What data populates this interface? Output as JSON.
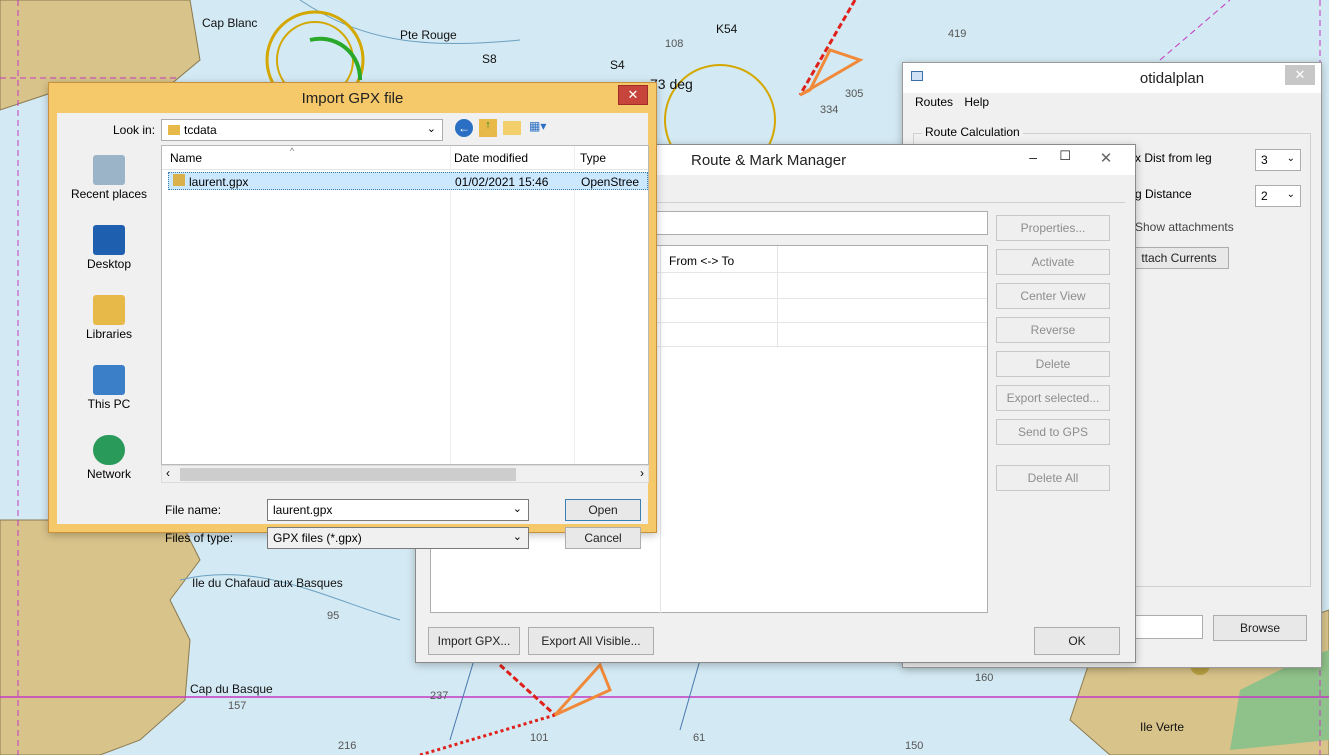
{
  "chart_labels": {
    "cap_blanc": "Cap Blanc",
    "pte_rouge": "Pte Rouge",
    "ile_chafaud": "Ile du Chafaud aux Basques",
    "cap_basque": "Cap du Basque",
    "ile_verte": "Ile Verte",
    "heading": "73 deg",
    "k54": "K54",
    "s8": "S8",
    "s4": "S4",
    "d419": "419",
    "d108": "108",
    "d305": "305",
    "d334": "334",
    "d160": "160",
    "d95": "95",
    "d157": "157",
    "d216": "216",
    "d237": "237",
    "d150": "150",
    "d61": "61",
    "d101": "101"
  },
  "import_gpx": {
    "title": "Import GPX file",
    "close": "✕",
    "look_in_label": "Look in:",
    "look_in_value": "tcdata",
    "places": [
      "Recent places",
      "Desktop",
      "Libraries",
      "This PC",
      "Network"
    ],
    "columns": {
      "name": "Name",
      "date": "Date modified",
      "type": "Type"
    },
    "file": {
      "name": "laurent.gpx",
      "date": "01/02/2021 15:46",
      "type": "OpenStree"
    },
    "file_name_label": "File name:",
    "file_name_value": "laurent.gpx",
    "file_type_label": "Files of type:",
    "file_type_value": "GPX files (*.gpx)",
    "open": "Open",
    "cancel": "Cancel"
  },
  "route_manager": {
    "title": "Route & Mark Manager",
    "column": "From <-> To",
    "buttons": [
      "Properties...",
      "Activate",
      "Center View",
      "Reverse",
      "Delete",
      "Export selected...",
      "Send to GPS",
      "Delete All"
    ],
    "import_gpx": "Import GPX...",
    "export_all": "Export All Visible...",
    "ok": "OK"
  },
  "otidalplan": {
    "title": "otidalplan",
    "menu": [
      "Routes",
      "Help"
    ],
    "group": "Route Calculation",
    "max_dist_label": "x Dist from leg",
    "max_dist_value": "3",
    "distance_label": "g Distance",
    "distance_value": "2",
    "show_attachments": "Show attachments",
    "attach_currents": "ttach Currents",
    "browse": "Browse"
  }
}
